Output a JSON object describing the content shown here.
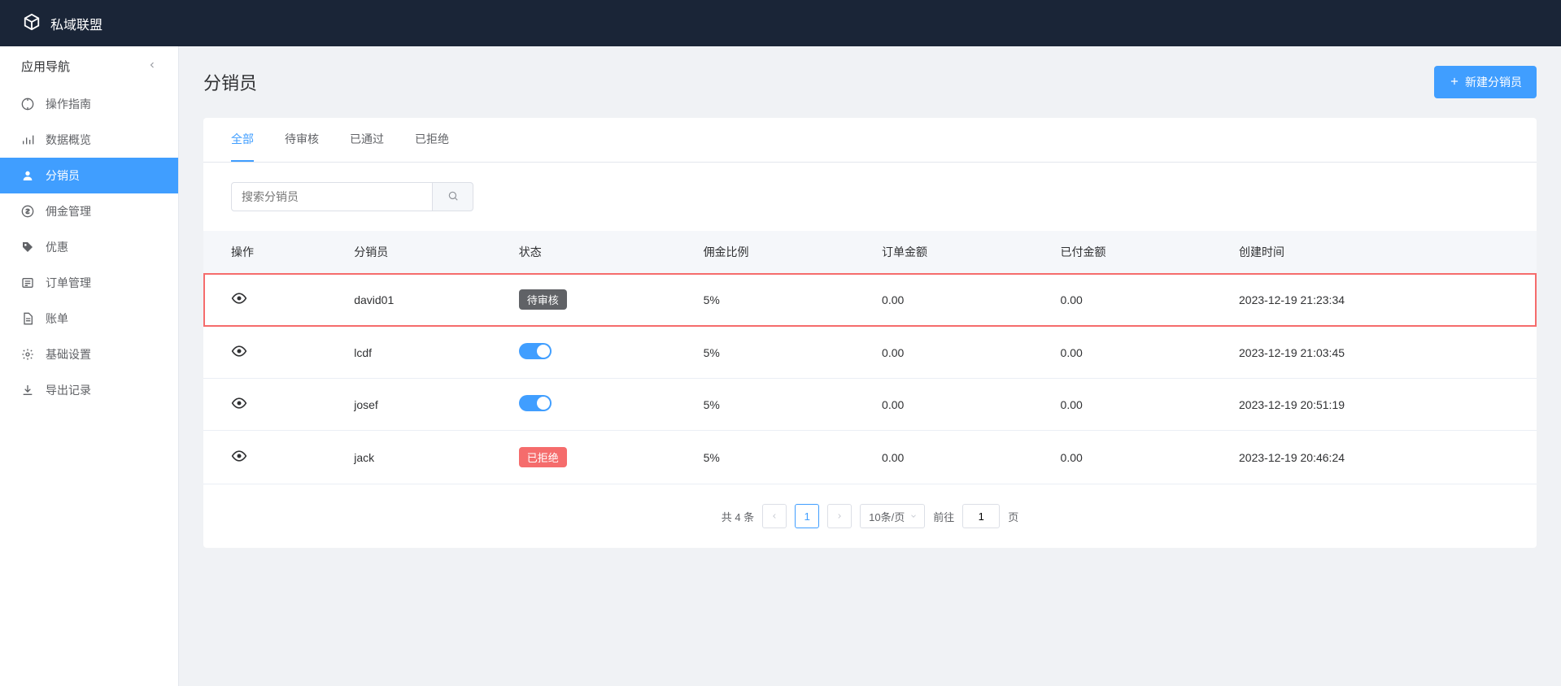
{
  "header": {
    "title": "私域联盟"
  },
  "sidebar": {
    "header": "应用导航",
    "items": [
      {
        "icon": "compass",
        "label": "操作指南"
      },
      {
        "icon": "chart-bar",
        "label": "数据概览"
      },
      {
        "icon": "user",
        "label": "分销员"
      },
      {
        "icon": "dollar",
        "label": "佣金管理"
      },
      {
        "icon": "tag",
        "label": "优惠"
      },
      {
        "icon": "list",
        "label": "订单管理"
      },
      {
        "icon": "file",
        "label": "账单"
      },
      {
        "icon": "gear",
        "label": "基础设置"
      },
      {
        "icon": "download",
        "label": "导出记录"
      }
    ],
    "active_index": 2
  },
  "page": {
    "title": "分销员",
    "create_button": "新建分销员"
  },
  "tabs": {
    "items": [
      "全部",
      "待审核",
      "已通过",
      "已拒绝"
    ],
    "active_index": 0
  },
  "search": {
    "placeholder": "搜索分销员",
    "value": ""
  },
  "table": {
    "columns": [
      "操作",
      "分销员",
      "状态",
      "佣金比例",
      "订单金额",
      "已付金额",
      "创建时间"
    ],
    "rows": [
      {
        "distributor": "david01",
        "status_type": "badge-gray",
        "status_label": "待审核",
        "rate": "5%",
        "order_amount": "0.00",
        "paid_amount": "0.00",
        "created_at": "2023-12-19 21:23:34",
        "highlighted": true
      },
      {
        "distributor": "lcdf",
        "status_type": "toggle",
        "status_label": "",
        "rate": "5%",
        "order_amount": "0.00",
        "paid_amount": "0.00",
        "created_at": "2023-12-19 21:03:45",
        "highlighted": false
      },
      {
        "distributor": "josef",
        "status_type": "toggle",
        "status_label": "",
        "rate": "5%",
        "order_amount": "0.00",
        "paid_amount": "0.00",
        "created_at": "2023-12-19 20:51:19",
        "highlighted": false
      },
      {
        "distributor": "jack",
        "status_type": "badge-red",
        "status_label": "已拒绝",
        "rate": "5%",
        "order_amount": "0.00",
        "paid_amount": "0.00",
        "created_at": "2023-12-19 20:46:24",
        "highlighted": false
      }
    ]
  },
  "pagination": {
    "total_text": "共 4 条",
    "current_page": "1",
    "page_size_label": "10条/页",
    "goto_prefix": "前往",
    "goto_value": "1",
    "goto_suffix": "页"
  }
}
